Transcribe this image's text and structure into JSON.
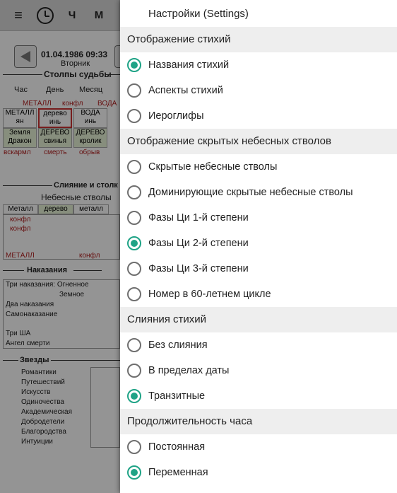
{
  "background": {
    "topbar": {
      "menu_glyph": "≡",
      "clock_icon": "clock-icon",
      "tab_ch": "Ч",
      "tab_m": "М"
    },
    "date": "01.04.1986 09:33",
    "weekday": "Вторник",
    "pillars_title": "Столпы судьбы",
    "pillar_headers": [
      "Час",
      "День",
      "Месяц"
    ],
    "element_row": [
      "МЕТАЛЛ",
      "конфл",
      "ВОДА"
    ],
    "stems_top": [
      "МЕТАЛЛ",
      "дерево",
      "ВОДА"
    ],
    "stems_bottom": [
      "ян",
      "инь",
      "инь"
    ],
    "branches_top": [
      "Земля",
      "ДЕРЕВО",
      "ДЕРЕВО"
    ],
    "branches_mid": [
      "Дракон",
      "свинья",
      "кролик"
    ],
    "branches_bottom": [
      "вскармл",
      "смерть",
      "обрыв"
    ],
    "merge_title": "Слияние и столк",
    "heaven_stems_title": "Небесные стволы",
    "heaven_row": [
      "Металл",
      "дерево",
      "металл"
    ],
    "conflicts": [
      "конфл",
      "конфл"
    ],
    "metal_label": "МЕТАЛЛ",
    "conf_label": "конфл",
    "punish_title": "Наказания",
    "punish_rows": [
      "Три наказания: Огненное",
      "Земное",
      "Два наказания",
      "Самонаказание",
      "Три ША",
      "Ангел смерти"
    ],
    "stars_title": "Звезды",
    "stars_rows": [
      "Романтики",
      "Путешествий",
      "Искусств",
      "Одиночества",
      "Академическая",
      "Добродетели",
      "Благородства",
      "Интуиции"
    ]
  },
  "drawer": {
    "title": "Настройки (Settings)",
    "accent": "#1fa386",
    "sections": [
      {
        "label": "Отображение стихий",
        "options": [
          {
            "label": "Названия стихий",
            "selected": true
          },
          {
            "label": "Аспекты стихий",
            "selected": false
          },
          {
            "label": "Иероглифы",
            "selected": false
          }
        ]
      },
      {
        "label": "Отображение скрытых небесных стволов",
        "options": [
          {
            "label": "Скрытые небесные стволы",
            "selected": false
          },
          {
            "label": "Доминирующие скрытые небесные стволы",
            "selected": false
          },
          {
            "label": "Фазы Ци 1-й степени",
            "selected": false
          },
          {
            "label": "Фазы Ци 2-й степени",
            "selected": true
          },
          {
            "label": "Фазы Ци 3-й степени",
            "selected": false
          },
          {
            "label": "Номер в 60-летнем цикле",
            "selected": false
          }
        ]
      },
      {
        "label": "Слияния стихий",
        "options": [
          {
            "label": "Без слияния",
            "selected": false
          },
          {
            "label": "В пределах даты",
            "selected": false
          },
          {
            "label": "Транзитные",
            "selected": true
          }
        ]
      },
      {
        "label": "Продолжительность часа",
        "options": [
          {
            "label": "Постоянная",
            "selected": false
          },
          {
            "label": "Переменная",
            "selected": true
          }
        ]
      }
    ]
  }
}
